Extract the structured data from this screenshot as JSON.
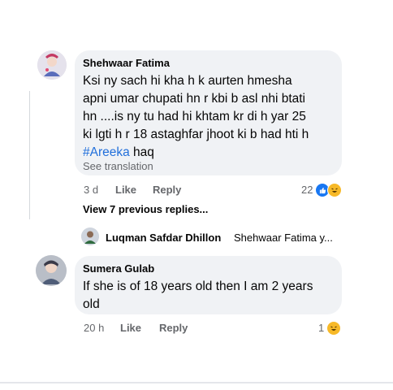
{
  "comments": [
    {
      "author": "Shehwaar Fatima",
      "text_lines": [
        "Ksi ny sach hi kha h k aurten hmesha",
        "apni umar chupati hn r kbi b asl nhi btati",
        "hn ....is ny tu had hi khtam kr di h yar 25",
        "ki lgti h r 18 astaghfar jhoot ki b had hti h"
      ],
      "hashtag": "#Areeka",
      "after_hashtag": " haq",
      "see_translation": "See translation",
      "time": "3 d",
      "like_label": "Like",
      "reply_label": "Reply",
      "reaction_count": "22",
      "reactions": [
        "like-icon",
        "haha-icon"
      ]
    },
    {
      "author": "Sumera Gulab",
      "text_lines": [
        "If she is of 18 years old then I am 2 years",
        "old"
      ],
      "time": "20 h",
      "like_label": "Like",
      "reply_label": "Reply",
      "reaction_count": "1",
      "reactions": [
        "haha-icon"
      ]
    }
  ],
  "view_replies": "View 7 previous replies...",
  "reply_preview": {
    "author": "Luqman Safdar Dhillon",
    "text": "Shehwaar Fatima y..."
  },
  "colors": {
    "bubble": "#f0f2f5",
    "hashtag": "#216fdb",
    "meta": "#65676b",
    "like": "#1877f2",
    "haha": "#f7b928"
  }
}
